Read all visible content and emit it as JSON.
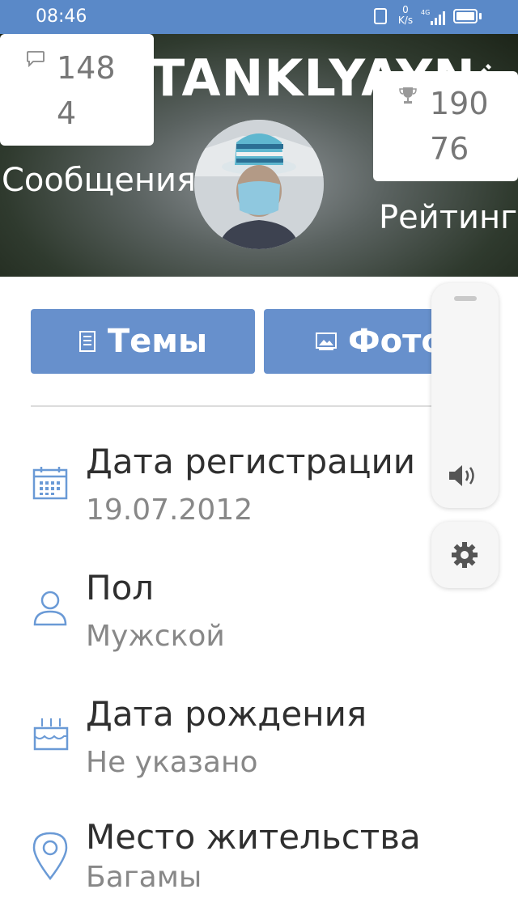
{
  "status_bar": {
    "time": "08:46",
    "net_speed_top": "0",
    "net_speed_unit": "K/s",
    "network_type": "4G"
  },
  "profile": {
    "username": "TANKLYAYN",
    "messages_count_line1": "148",
    "messages_count_line2": "4",
    "messages_label": "Сообщения",
    "rating_count_line1": "190",
    "rating_count_line2": "76",
    "rating_label": "Рейтинг"
  },
  "actions": {
    "topics_label": "Темы",
    "photos_label": "Фото"
  },
  "info": [
    {
      "title": "Дата регистрации",
      "value": "19.07.2012",
      "icon": "calendar-icon"
    },
    {
      "title": "Пол",
      "value": "Мужской",
      "icon": "user-icon"
    },
    {
      "title": "Дата рождения",
      "value": "Не указано",
      "icon": "cake-icon"
    },
    {
      "title": "Место жительства",
      "value": "Багамы",
      "icon": "location-pin-icon"
    }
  ],
  "colors": {
    "status_bar": "#5a89c8",
    "button": "#6790cc",
    "icon_accent": "#6a9ad6"
  }
}
